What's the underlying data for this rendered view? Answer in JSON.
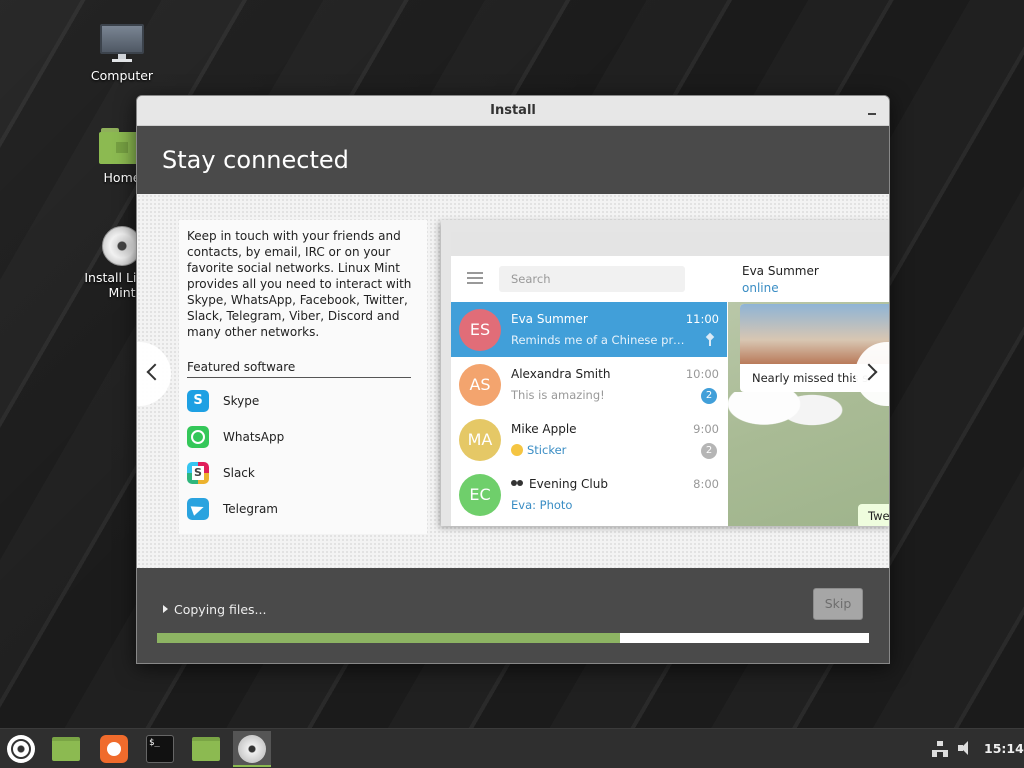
{
  "desktop": {
    "icons": [
      {
        "label": "Computer",
        "icon": "computer-icon"
      },
      {
        "label": "Home",
        "icon": "home-folder-icon"
      },
      {
        "label": "Install Linux Mint",
        "icon": "disc-icon"
      }
    ]
  },
  "window": {
    "title": "Install",
    "header_title": "Stay connected",
    "description": "Keep in touch with your friends and contacts, by email, IRC or on your favorite social networks. Linux Mint provides all you need to interact with Skype, WhatsApp, Facebook, Twitter, Slack, Telegram, Viber, Discord and many other networks.",
    "featured_title": "Featured software",
    "featured_apps": [
      {
        "name": "Skype",
        "icon": "skype-icon"
      },
      {
        "name": "WhatsApp",
        "icon": "whatsapp-icon"
      },
      {
        "name": "Slack",
        "icon": "slack-icon"
      },
      {
        "name": "Telegram",
        "icon": "telegram-icon"
      }
    ],
    "telegram": {
      "search_placeholder": "Search",
      "chats": [
        {
          "initials": "ES",
          "name": "Eva Summer",
          "time": "11:00",
          "message": "Reminds me of a Chinese proverb...",
          "color": "#e16d78",
          "active": true
        },
        {
          "initials": "AS",
          "name": "Alexandra Smith",
          "time": "10:00",
          "message": "This is amazing!",
          "badge": "2",
          "color": "#f3a46e"
        },
        {
          "initials": "MA",
          "name": "Mike Apple",
          "time": "9:00",
          "message": "Sticker",
          "badge": "2",
          "color": "#e5c866"
        },
        {
          "initials": "EC",
          "name": "Evening Club",
          "time": "8:00",
          "message": "Eva: Photo",
          "color": "#6fcf6b"
        }
      ],
      "chat_header_name": "Eva Summer",
      "chat_header_status": "online",
      "photo_caption": "Nearly missed this s",
      "tweet_fragment": "Twe"
    },
    "footer": {
      "status": "Copying files...",
      "skip_label": "Skip",
      "progress": 0.65
    }
  },
  "taskbar": {
    "items": [
      "mint-menu-icon",
      "files-icon",
      "firefox-icon",
      "terminal-icon",
      "files-icon",
      "installer-disc-icon"
    ],
    "terminal_glyph": "$_",
    "clock": "15:14"
  },
  "colors": {
    "accent": "#8db463",
    "selected_chat": "#419fd9",
    "header_bg": "#4a4a4a"
  }
}
